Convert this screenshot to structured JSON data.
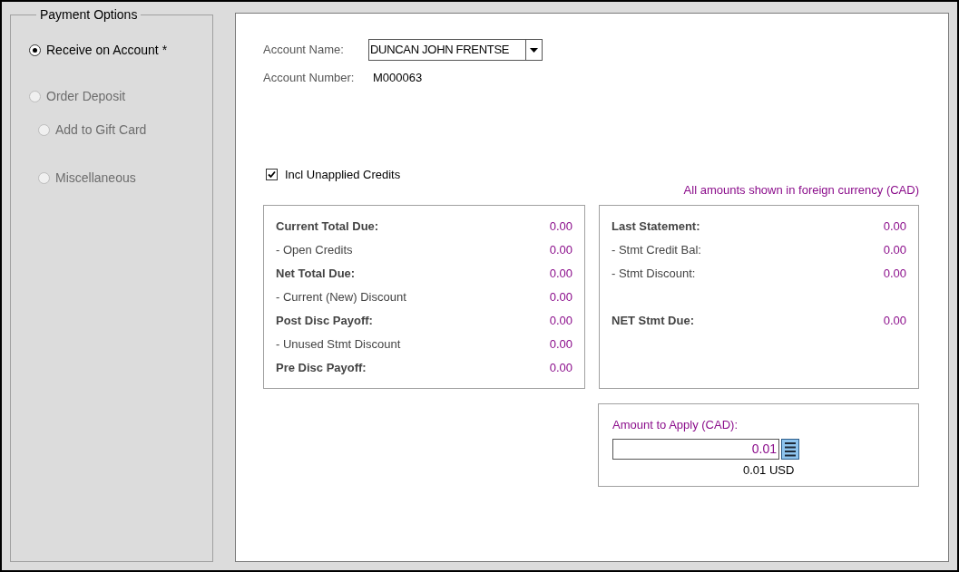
{
  "payment_options": {
    "title": "Payment Options",
    "options": [
      {
        "label": "Receive on Account *",
        "selected": true,
        "disabled": false
      },
      {
        "label": "Order Deposit",
        "selected": false,
        "disabled": true,
        "children": [
          {
            "label": "Add to Gift Card",
            "selected": false,
            "disabled": true
          },
          {
            "label": "Miscellaneous",
            "selected": false,
            "disabled": true
          }
        ]
      }
    ]
  },
  "account": {
    "name_label": "Account Name:",
    "name_value": "DUNCAN JOHN FRENTSE",
    "number_label": "Account Number:",
    "number_value": "M000063"
  },
  "incl_unapplied": {
    "label": "Incl Unapplied Credits",
    "checked": true
  },
  "currency_note": "All amounts shown in foreign currency (CAD)",
  "totals": [
    {
      "label": "Current Total Due:",
      "value": "0.00",
      "kind": "total"
    },
    {
      "label": "- Open Credits",
      "value": "0.00",
      "kind": "item"
    },
    {
      "label": "Net Total Due:",
      "value": "0.00",
      "kind": "total"
    },
    {
      "label": "- Current (New) Discount",
      "value": "0.00",
      "kind": "item"
    },
    {
      "label": "Post Disc Payoff:",
      "value": "0.00",
      "kind": "total"
    },
    {
      "label": "- Unused Stmt Discount",
      "value": "0.00",
      "kind": "item"
    },
    {
      "label": "Pre Disc Payoff:",
      "value": "0.00",
      "kind": "total"
    }
  ],
  "statement": [
    {
      "label": "Last Statement:",
      "value": "0.00",
      "kind": "total"
    },
    {
      "label": "- Stmt Credit Bal:",
      "value": "0.00",
      "kind": "item"
    },
    {
      "label": "- Stmt Discount:",
      "value": "0.00",
      "kind": "item"
    }
  ],
  "net_statement_due": {
    "label": "NET Stmt Due:",
    "value": "0.00",
    "kind": "total"
  },
  "amount_to_apply": {
    "label": "Amount to Apply (CAD):",
    "value": "0.01",
    "converted": "0.01 USD"
  }
}
